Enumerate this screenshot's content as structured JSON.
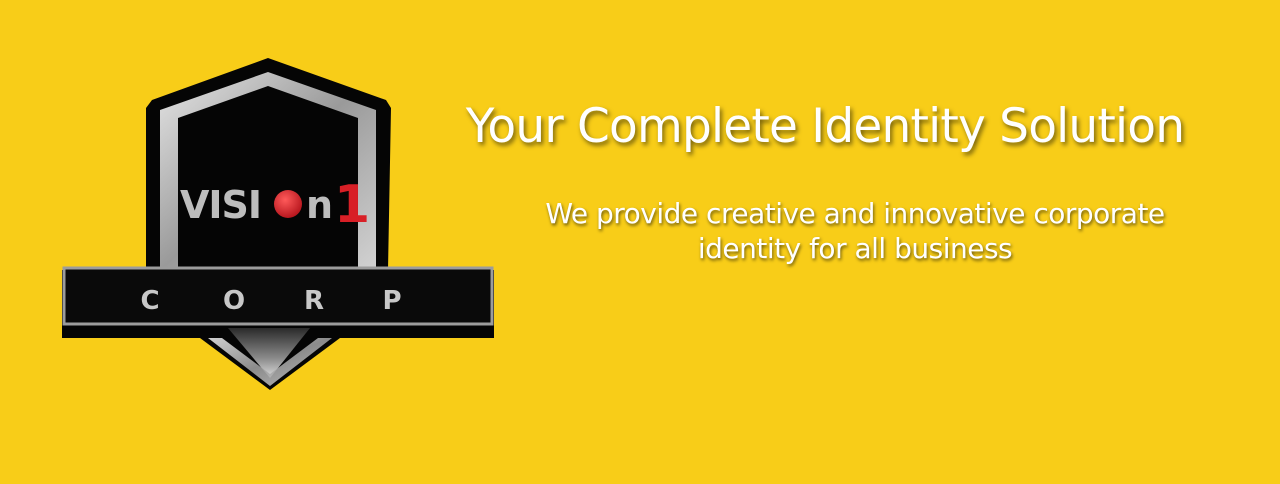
{
  "colors": {
    "background": "#f8cd18",
    "text": "#ffffff",
    "logo_black": "#050505",
    "logo_silver": "#bdbdbd",
    "logo_red": "#d81f26"
  },
  "logo": {
    "brand_prefix": "VISI",
    "brand_suffix": "n",
    "brand_number": "1",
    "sub_letters": [
      "C",
      "O",
      "R",
      "P"
    ]
  },
  "hero": {
    "headline": "Your Complete Identity Solution",
    "tagline_line1": "We provide creative and innovative corporate",
    "tagline_line2": "identity for all business"
  }
}
